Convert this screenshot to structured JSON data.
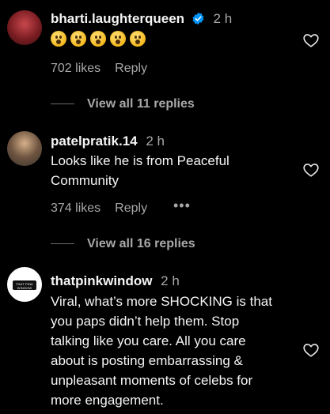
{
  "comments": [
    {
      "username": "bharti.laughterqueen",
      "time": "2 h",
      "verified": true,
      "emojis": [
        "astonished-emoji",
        "astonished-emoji",
        "astonished-emoji",
        "astonished-emoji",
        "astonished-emoji"
      ],
      "likes": "702 likes",
      "reply": "Reply",
      "view_replies": "View all 11 replies"
    },
    {
      "username": "patelpratik.14",
      "time": "2 h",
      "text_lines": [
        "Looks like he is from Peaceful",
        "Community"
      ],
      "likes": "374 likes",
      "reply": "Reply",
      "more": "•••",
      "view_replies": "View all 16 replies"
    },
    {
      "username": "thatpinkwindow",
      "time": "2 h",
      "avatar_text": "THAT PINK WINDOW",
      "text_lines": [
        "Viral, what’s more SHOCKING is that",
        "you paps didn’t help them. Stop",
        "talking like you care. All you care",
        "about is posting embarrassing &",
        "unpleasant moments of celebs for",
        "more engagement."
      ]
    }
  ],
  "colors": {
    "background": "#000000",
    "primary_text": "#f5f5f5",
    "secondary_text": "#a8a8a8",
    "verified_blue": "#0095f6"
  }
}
